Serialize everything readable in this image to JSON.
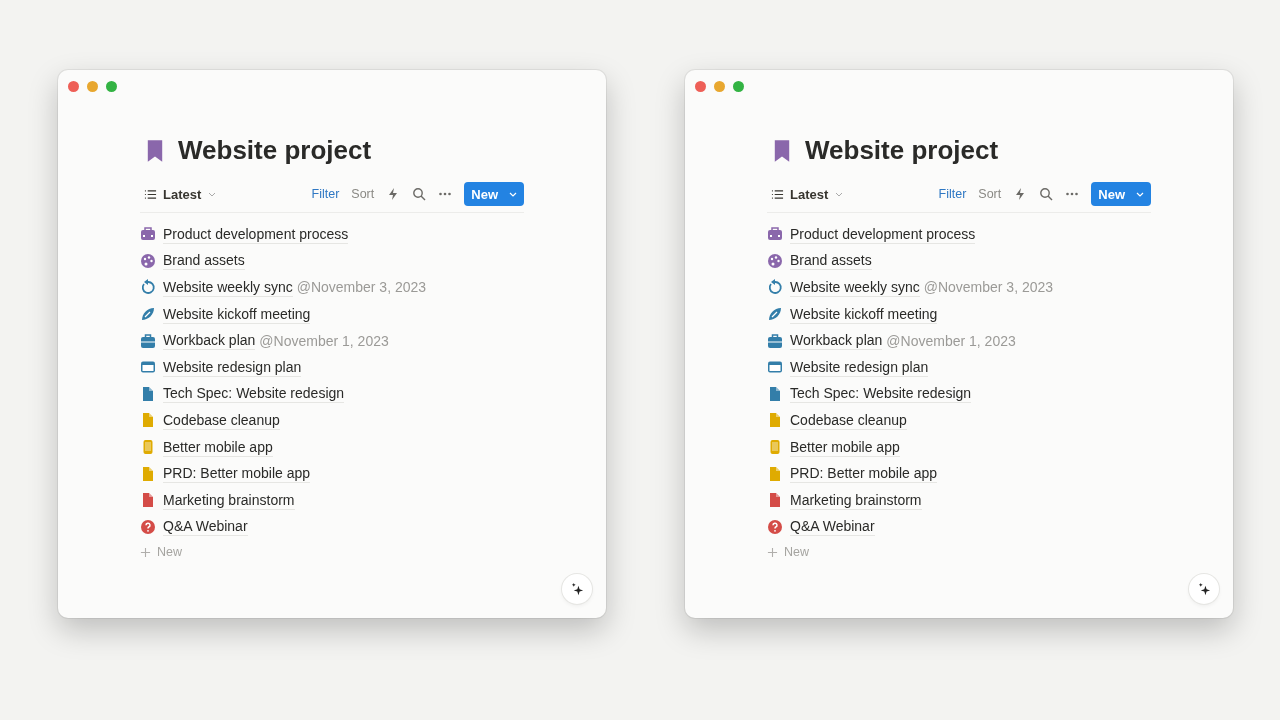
{
  "windows": [
    {
      "title": "Website project",
      "view": "Latest",
      "actions": [
        {
          "label": "Filter",
          "active": true
        },
        {
          "label": "Sort",
          "active": false
        }
      ],
      "new_button": "New",
      "add_label": "New",
      "items": [
        {
          "kind": "toolbox",
          "color": "#8a67ab",
          "title": "Product development process"
        },
        {
          "kind": "palette",
          "color": "#8a67ab",
          "title": "Brand assets"
        },
        {
          "kind": "repeat",
          "color": "#337ea9",
          "title": "Website weekly sync",
          "mention": "@November 3, 2023"
        },
        {
          "kind": "rocket",
          "color": "#337ea9",
          "title": "Website kickoff meeting"
        },
        {
          "kind": "briefcase",
          "color": "#337ea9",
          "title": "Workback plan",
          "mention": "@November 1, 2023"
        },
        {
          "kind": "browser",
          "color": "#337ea9",
          "title": "Website redesign plan"
        },
        {
          "kind": "document",
          "color": "#337ea9",
          "title": "Tech Spec: Website redesign"
        },
        {
          "kind": "document",
          "color": "#dfab01",
          "title": "Codebase cleanup"
        },
        {
          "kind": "phone",
          "color": "#dfab01",
          "title": "Better mobile app"
        },
        {
          "kind": "document",
          "color": "#dfab01",
          "title": "PRD: Better mobile app"
        },
        {
          "kind": "document",
          "color": "#d44c47",
          "title": "Marketing brainstorm"
        },
        {
          "kind": "question",
          "color": "#d44c47",
          "title": "Q&A Webinar"
        }
      ]
    },
    {
      "title": "Website project",
      "view": "Latest",
      "actions": [
        {
          "label": "Filter",
          "active": true
        },
        {
          "label": "Sort",
          "active": false
        }
      ],
      "new_button": "New",
      "add_label": "New",
      "items": [
        {
          "kind": "toolbox",
          "color": "#8a67ab",
          "title": "Product development process"
        },
        {
          "kind": "palette",
          "color": "#8a67ab",
          "title": "Brand assets"
        },
        {
          "kind": "repeat",
          "color": "#337ea9",
          "title": "Website weekly sync",
          "mention": "@November 3, 2023"
        },
        {
          "kind": "rocket",
          "color": "#337ea9",
          "title": "Website kickoff meeting"
        },
        {
          "kind": "briefcase",
          "color": "#337ea9",
          "title": "Workback plan",
          "mention": "@November 1, 2023"
        },
        {
          "kind": "browser",
          "color": "#337ea9",
          "title": "Website redesign plan"
        },
        {
          "kind": "document",
          "color": "#337ea9",
          "title": "Tech Spec: Website redesign"
        },
        {
          "kind": "document",
          "color": "#dfab01",
          "title": "Codebase cleanup"
        },
        {
          "kind": "phone",
          "color": "#dfab01",
          "title": "Better mobile app"
        },
        {
          "kind": "document",
          "color": "#dfab01",
          "title": "PRD: Better mobile app"
        },
        {
          "kind": "document",
          "color": "#d44c47",
          "title": "Marketing brainstorm"
        },
        {
          "kind": "question",
          "color": "#d44c47",
          "title": "Q&A Webinar"
        }
      ]
    }
  ]
}
